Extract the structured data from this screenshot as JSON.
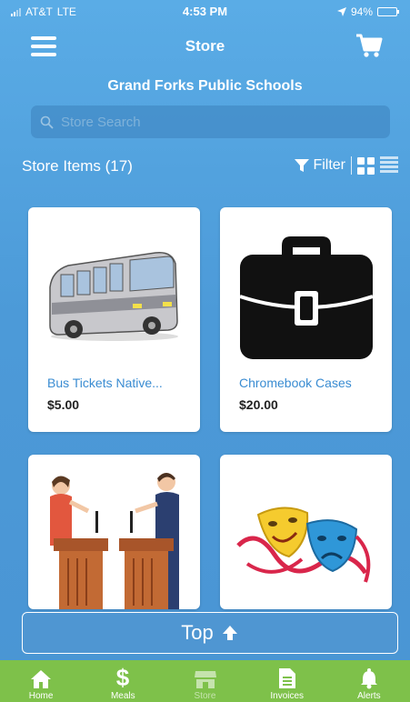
{
  "status_bar": {
    "carrier": "AT&T",
    "network": "LTE",
    "time": "4:53 PM",
    "battery": "94%",
    "battery_level": 0.94
  },
  "nav": {
    "title": "Store"
  },
  "school_name": "Grand Forks Public Schools",
  "search": {
    "placeholder": "Store Search"
  },
  "store": {
    "count_label": "Store Items (17)",
    "filter_label": "Filter"
  },
  "items": [
    {
      "name": "Bus Tickets Native...",
      "price": "$5.00"
    },
    {
      "name": "Chromebook Cases",
      "price": "$20.00"
    }
  ],
  "top_button": {
    "label": "Top"
  },
  "tabs": [
    {
      "label": "Home"
    },
    {
      "label": "Meals"
    },
    {
      "label": "Store"
    },
    {
      "label": "Invoices"
    },
    {
      "label": "Alerts"
    }
  ],
  "colors": {
    "background": "#4c9ad8",
    "tab_bar": "#7ec14a",
    "item_name": "#3a8cd2"
  }
}
